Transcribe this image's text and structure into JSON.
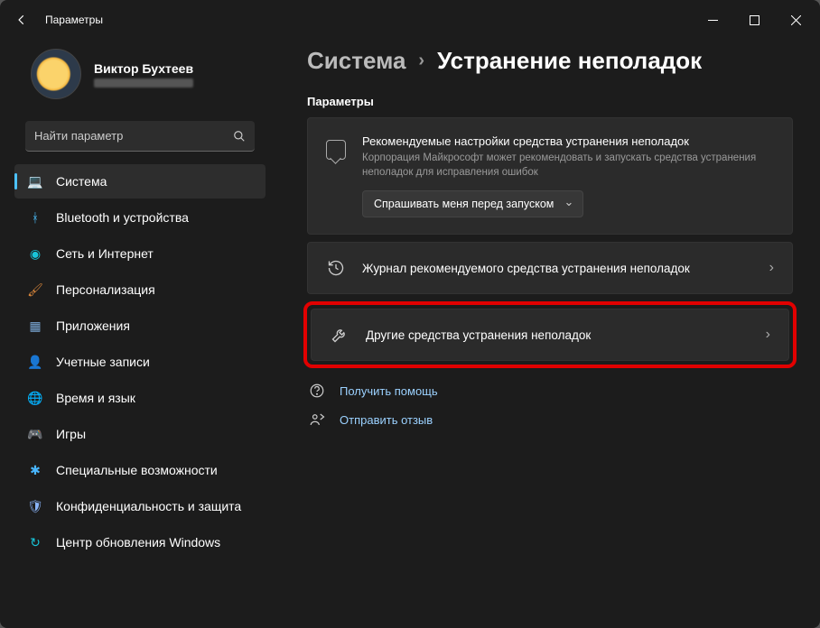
{
  "window": {
    "title": "Параметры"
  },
  "profile": {
    "name": "Виктор Бухтеев"
  },
  "search": {
    "placeholder": "Найти параметр"
  },
  "nav": {
    "items": [
      {
        "key": "system",
        "label": "Система",
        "icon": "💻",
        "color": "#4cc2ff",
        "active": true
      },
      {
        "key": "bluetooth",
        "label": "Bluetooth и устройства",
        "icon": "ᚼ",
        "color": "#4cc2ff"
      },
      {
        "key": "network",
        "label": "Сеть и Интернет",
        "icon": "◉",
        "color": "#18c5d9"
      },
      {
        "key": "personal",
        "label": "Персонализация",
        "icon": "🖌",
        "color": "#e08a3c"
      },
      {
        "key": "apps",
        "label": "Приложения",
        "icon": "▦",
        "color": "#7aa8d6"
      },
      {
        "key": "accounts",
        "label": "Учетные записи",
        "icon": "👤",
        "color": "#29c06e"
      },
      {
        "key": "time",
        "label": "Время и язык",
        "icon": "🌐",
        "color": "#4cc2ff"
      },
      {
        "key": "games",
        "label": "Игры",
        "icon": "🎮",
        "color": "#9aa0a6"
      },
      {
        "key": "access",
        "label": "Специальные возможности",
        "icon": "✱",
        "color": "#49b6ff"
      },
      {
        "key": "privacy",
        "label": "Конфиденциальность и защита",
        "icon": "🛡",
        "color": "#8ab4f8"
      },
      {
        "key": "update",
        "label": "Центр обновления Windows",
        "icon": "↻",
        "color": "#18c5d9"
      }
    ]
  },
  "breadcrumb": {
    "root": "Система",
    "current": "Устранение неполадок"
  },
  "section_label": "Параметры",
  "recommended": {
    "title": "Рекомендуемые настройки средства устранения неполадок",
    "desc": "Корпорация Майкрософт может рекомендовать и запускать средства устранения неполадок для исправления ошибок",
    "dropdown": "Спрашивать меня перед запуском"
  },
  "rows": {
    "history": "Журнал рекомендуемого средства устранения неполадок",
    "other": "Другие средства устранения неполадок"
  },
  "links": {
    "help": "Получить помощь",
    "feedback": "Отправить отзыв"
  }
}
